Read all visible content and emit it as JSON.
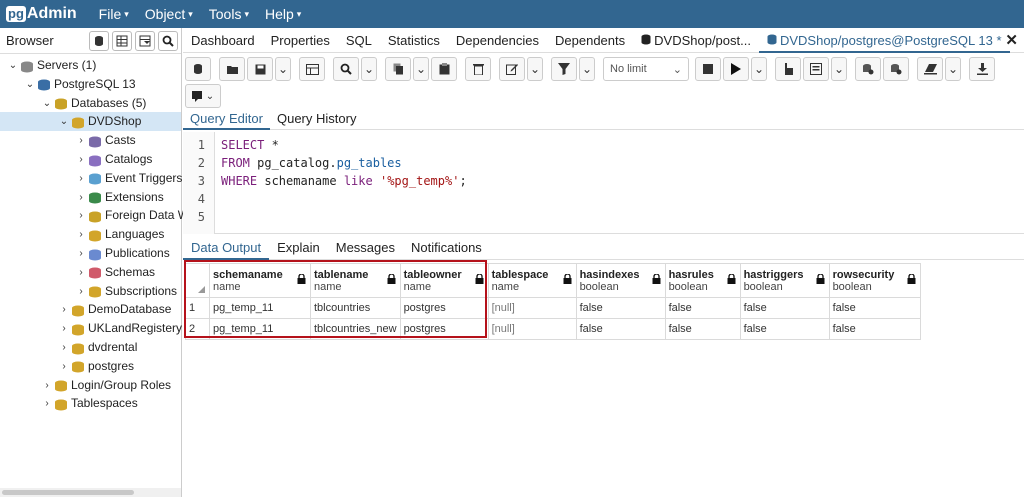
{
  "app": {
    "logo_pg": "pg",
    "logo_admin": "Admin"
  },
  "menu": [
    {
      "label": "File"
    },
    {
      "label": "Object"
    },
    {
      "label": "Tools"
    },
    {
      "label": "Help"
    }
  ],
  "browser": {
    "title": "Browser",
    "tree": [
      {
        "label": "Servers (1)",
        "arrow": "⌄",
        "level": 0
      },
      {
        "label": "PostgreSQL 13",
        "arrow": "⌄",
        "level": 1
      },
      {
        "label": "Databases (5)",
        "arrow": "⌄",
        "level": 2
      },
      {
        "label": "DVDShop",
        "arrow": "⌄",
        "level": 3,
        "selected": true
      },
      {
        "label": "Casts",
        "arrow": "›",
        "level": 4
      },
      {
        "label": "Catalogs",
        "arrow": "›",
        "level": 4
      },
      {
        "label": "Event Triggers",
        "arrow": "›",
        "level": 4
      },
      {
        "label": "Extensions",
        "arrow": "›",
        "level": 4
      },
      {
        "label": "Foreign Data Wr",
        "arrow": "›",
        "level": 4
      },
      {
        "label": "Languages",
        "arrow": "›",
        "level": 4
      },
      {
        "label": "Publications",
        "arrow": "›",
        "level": 4
      },
      {
        "label": "Schemas",
        "arrow": "›",
        "level": 4
      },
      {
        "label": "Subscriptions",
        "arrow": "›",
        "level": 4
      },
      {
        "label": "DemoDatabase",
        "arrow": "›",
        "level": 3
      },
      {
        "label": "UKLandRegistery",
        "arrow": "›",
        "level": 3
      },
      {
        "label": "dvdrental",
        "arrow": "›",
        "level": 3
      },
      {
        "label": "postgres",
        "arrow": "›",
        "level": 3
      },
      {
        "label": "Login/Group Roles",
        "arrow": "›",
        "level": 2
      },
      {
        "label": "Tablespaces",
        "arrow": "›",
        "level": 2
      }
    ]
  },
  "tabs": [
    {
      "label": "Dashboard"
    },
    {
      "label": "Properties"
    },
    {
      "label": "SQL"
    },
    {
      "label": "Statistics"
    },
    {
      "label": "Dependencies"
    },
    {
      "label": "Dependents"
    },
    {
      "label": "DVDShop/post..."
    },
    {
      "label": "DVDShop/postgres@PostgreSQL 13 *",
      "active": true
    }
  ],
  "toolbar": {
    "limit_label": "No limit"
  },
  "query_tabs": [
    {
      "label": "Query Editor",
      "active": true
    },
    {
      "label": "Query History"
    }
  ],
  "editor": {
    "lines": [
      {
        "n": "1",
        "parts": [
          [
            "kw",
            "SELECT"
          ],
          [
            "",
            " *"
          ]
        ]
      },
      {
        "n": "2",
        "parts": [
          [
            "kw",
            "FROM"
          ],
          [
            "",
            " pg_catalog."
          ],
          [
            "fn",
            "pg_tables"
          ]
        ]
      },
      {
        "n": "3",
        "parts": [
          [
            "kw",
            "WHERE"
          ],
          [
            "",
            " schemaname "
          ],
          [
            "kw",
            "like"
          ],
          [
            "",
            " "
          ],
          [
            "str",
            "'%pg_temp%'"
          ],
          [
            "",
            ";"
          ]
        ]
      },
      {
        "n": "4",
        "parts": []
      },
      {
        "n": "5",
        "parts": []
      }
    ]
  },
  "output_tabs": [
    {
      "label": "Data Output",
      "active": true
    },
    {
      "label": "Explain"
    },
    {
      "label": "Messages"
    },
    {
      "label": "Notifications"
    }
  ],
  "grid": {
    "columns": [
      {
        "name": "schemaname",
        "type": "name"
      },
      {
        "name": "tablename",
        "type": "name"
      },
      {
        "name": "tableowner",
        "type": "name"
      },
      {
        "name": "tablespace",
        "type": "name"
      },
      {
        "name": "hasindexes",
        "type": "boolean"
      },
      {
        "name": "hasrules",
        "type": "boolean"
      },
      {
        "name": "hastriggers",
        "type": "boolean"
      },
      {
        "name": "rowsecurity",
        "type": "boolean"
      }
    ],
    "rows": [
      {
        "num": "1",
        "cells": [
          "pg_temp_11",
          "tblcountries",
          "postgres",
          "[null]",
          "false",
          "false",
          "false",
          "false"
        ]
      },
      {
        "num": "2",
        "cells": [
          "pg_temp_11",
          "tblcountries_new",
          "postgres",
          "[null]",
          "false",
          "false",
          "false",
          "false"
        ]
      }
    ]
  },
  "colors": {
    "brand": "#326690",
    "highlight": "#b5121b",
    "selected": "#d4e6f5"
  }
}
